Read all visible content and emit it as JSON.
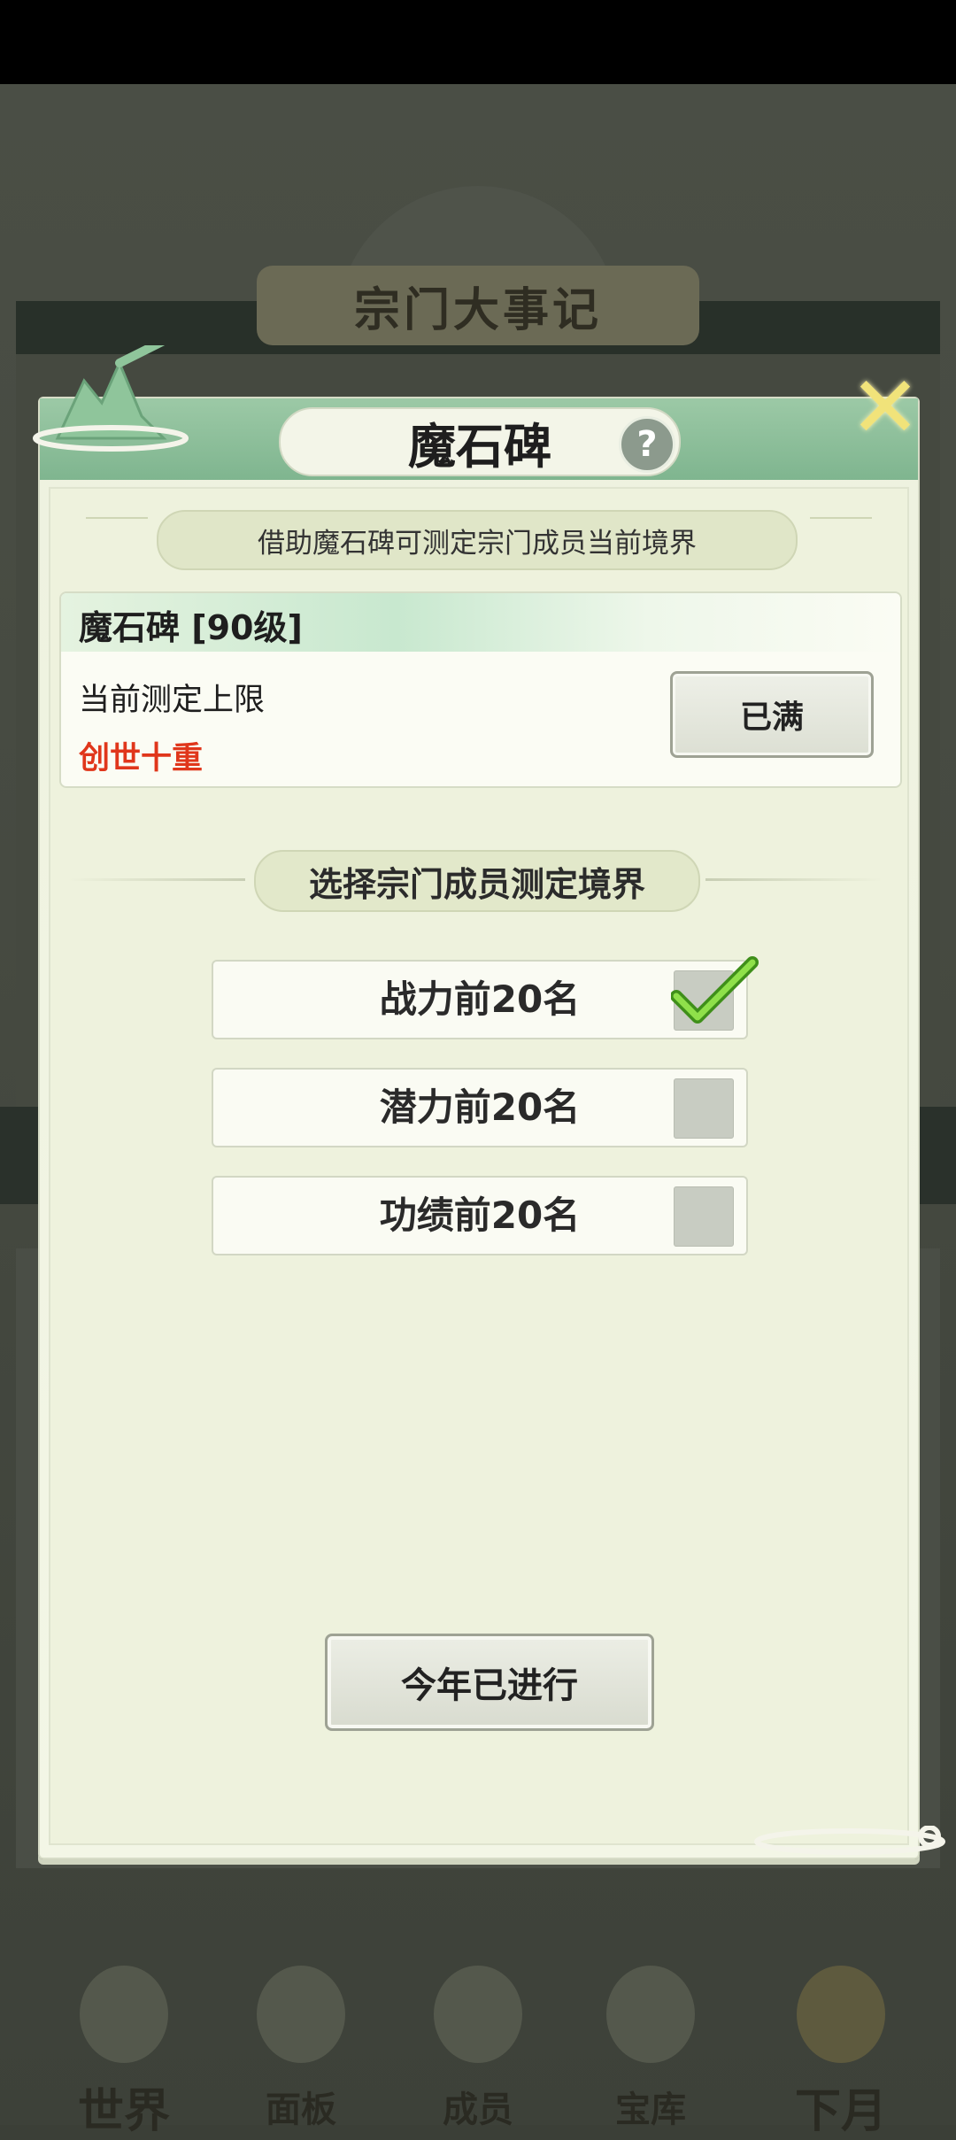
{
  "background": {
    "title": "宗门大事记"
  },
  "modal": {
    "title": "魔石碑",
    "help_label": "?",
    "description": "借助魔石碑可测定宗门成员当前境界",
    "info_card": {
      "title": "魔石碑 [90级]",
      "limit_label": "当前测定上限",
      "limit_value": "创世十重",
      "status_button": "已满"
    },
    "section_title": "选择宗门成员测定境界",
    "options": [
      {
        "label": "战力前20名",
        "checked": true
      },
      {
        "label": "潜力前20名",
        "checked": false
      },
      {
        "label": "功绩前20名",
        "checked": false
      }
    ],
    "action_button": "今年已进行"
  },
  "bottom_nav": {
    "items": [
      {
        "label": "世界"
      },
      {
        "label": "面板"
      },
      {
        "label": "成员"
      },
      {
        "label": "宝库"
      },
      {
        "label": "下月"
      }
    ]
  },
  "colors": {
    "header_green": "#86bb95",
    "realm_red": "#e0361b",
    "check_green": "#6fcf2e"
  }
}
